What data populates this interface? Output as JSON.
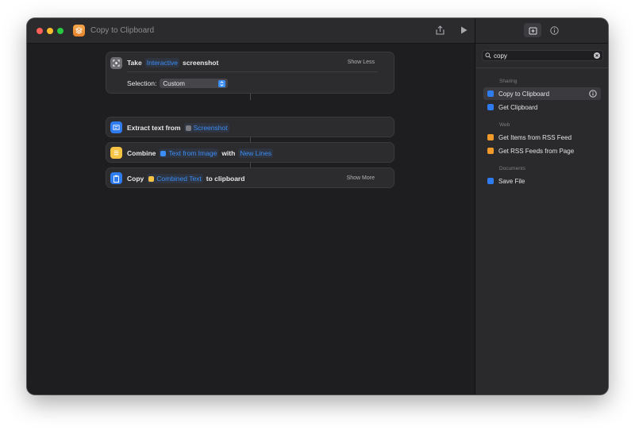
{
  "window": {
    "title": "Copy to Clipboard"
  },
  "colors": {
    "close": "#fe5f57",
    "minimize": "#febc2e",
    "zoom": "#28c840",
    "accent": "#3a8ef6"
  },
  "actions": [
    {
      "verb": "Take",
      "token": "Interactive",
      "noun": "screenshot",
      "toggle": "Show Less",
      "param_label": "Selection:",
      "param_value": "Custom",
      "icon": "screenshot-icon"
    },
    {
      "verb": "Extract text from",
      "token": "Screenshot",
      "icon": "text-scan-icon"
    },
    {
      "verb": "Combine",
      "token": "Text from Image",
      "mid": "with",
      "token2": "New Lines",
      "icon": "list-icon"
    },
    {
      "verb": "Copy",
      "token": "Combined Text",
      "suffix": "to clipboard",
      "toggle": "Show More",
      "icon": "clipboard-icon"
    }
  ],
  "sidebar": {
    "search": {
      "value": "copy"
    },
    "sections": [
      {
        "title": "Sharing",
        "items": [
          "Copy to Clipboard",
          "Get Clipboard"
        ]
      },
      {
        "title": "Web",
        "items": [
          "Get Items from RSS Feed",
          "Get RSS Feeds from Page"
        ]
      },
      {
        "title": "Documents",
        "items": [
          "Save File"
        ]
      }
    ]
  }
}
